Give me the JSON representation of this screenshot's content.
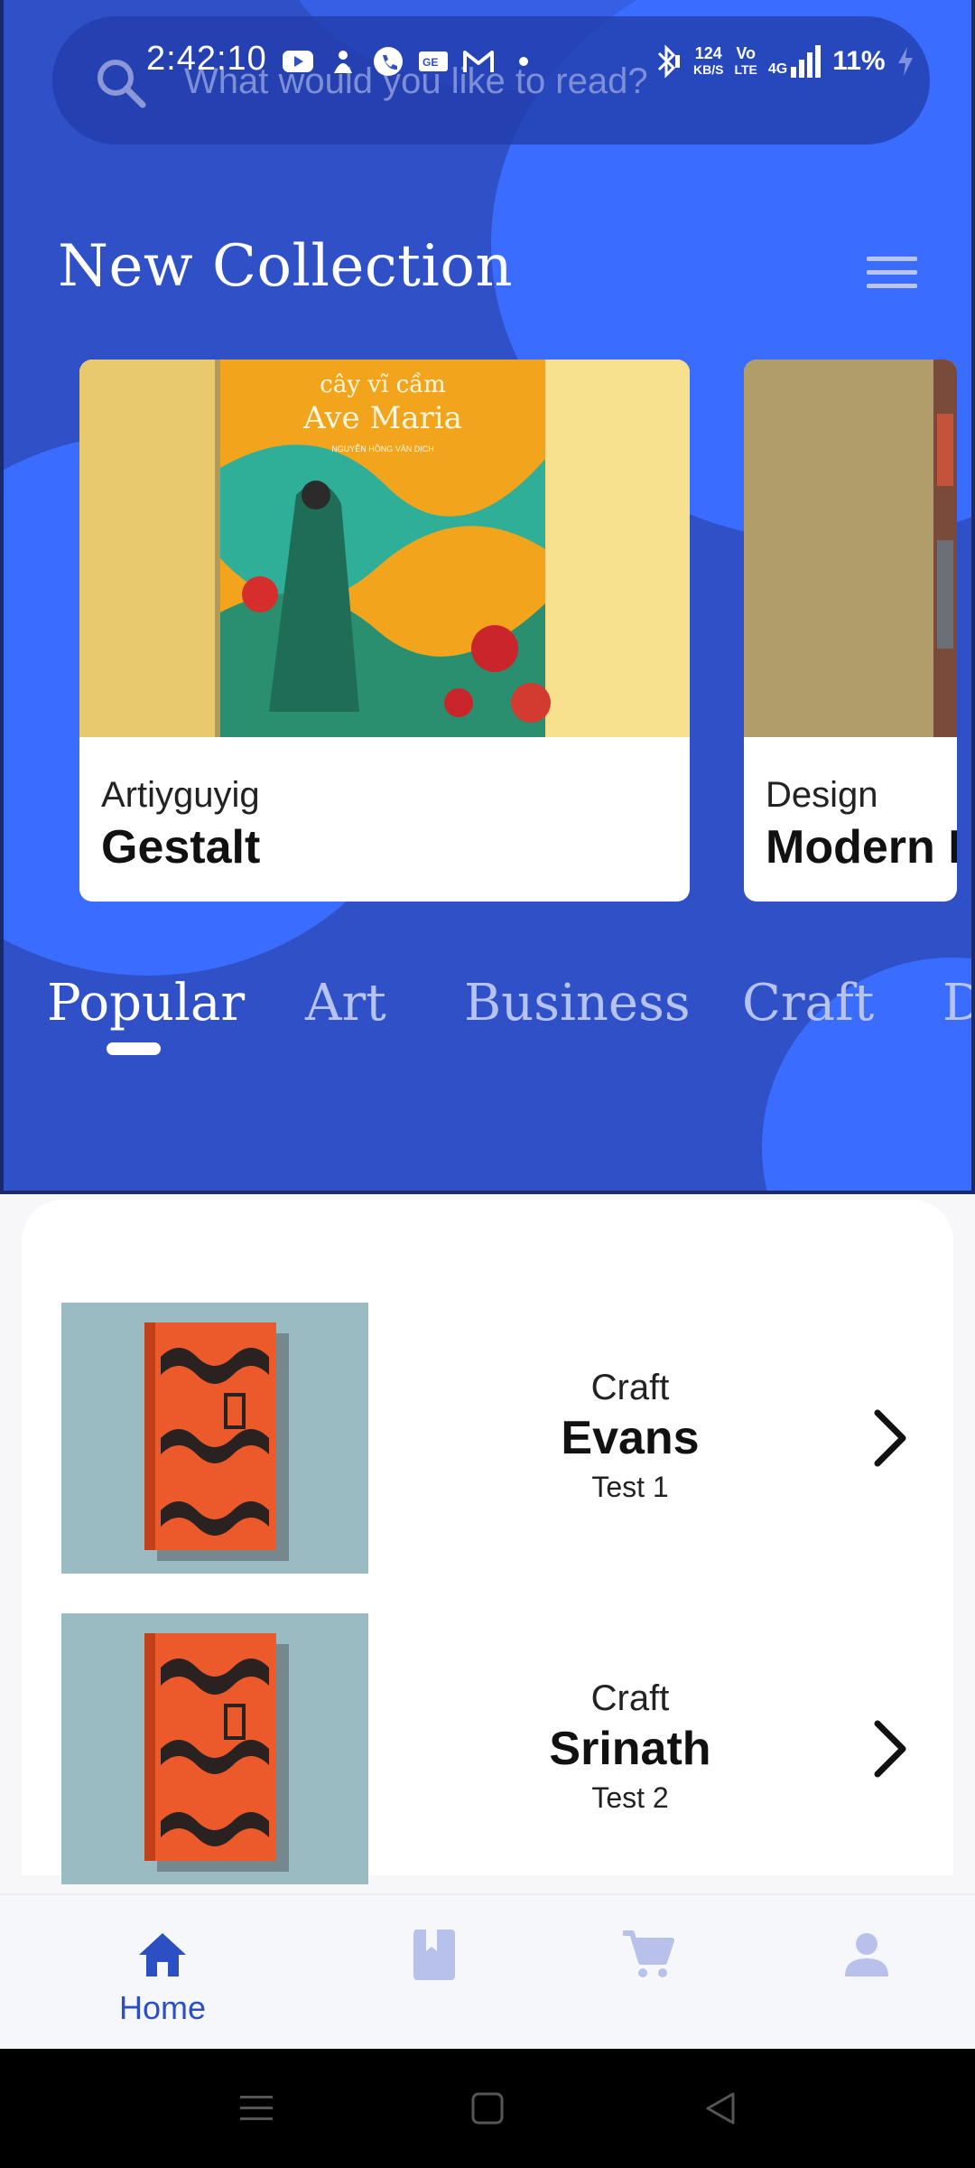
{
  "status_bar": {
    "time": "2:42:10",
    "net_speed_value": "124",
    "net_speed_unit": "KB/S",
    "volte_line1": "Vo",
    "volte_line2": "LTE",
    "network": "4G",
    "battery": "11%"
  },
  "search": {
    "placeholder": "What would you like to read?",
    "icon": "search-icon"
  },
  "header": {
    "title": "New Collection",
    "menu_icon": "menu-icon"
  },
  "collection": [
    {
      "category": "Artiyguyig",
      "title": "Gestalt",
      "cover_text_1": "cây vĩ cầm",
      "cover_text_2": "Ave Maria",
      "cover_text_3": "NGUYỄN HỒNG VÂN DỊCH"
    },
    {
      "category": "Design",
      "title": "Modern D"
    }
  ],
  "tabs": [
    {
      "label": "Popular",
      "active": true
    },
    {
      "label": "Art",
      "active": false
    },
    {
      "label": "Business",
      "active": false
    },
    {
      "label": "Craft",
      "active": false
    },
    {
      "label": "D",
      "active": false
    }
  ],
  "list": [
    {
      "category": "Craft",
      "title": "Evans",
      "subtitle": "Test 1"
    },
    {
      "category": "Craft",
      "title": "Srinath",
      "subtitle": "Test 2"
    }
  ],
  "bottom_nav": {
    "items": [
      {
        "label": "Home",
        "icon": "home-icon",
        "active": true
      },
      {
        "label": "",
        "icon": "book-icon",
        "active": false
      },
      {
        "label": "",
        "icon": "cart-icon",
        "active": false
      },
      {
        "label": "",
        "icon": "person-icon",
        "active": false
      }
    ]
  },
  "colors": {
    "hero_blue": "#2f50c7",
    "blob_blue": "#3a6cff",
    "accent": "#2d4fc4",
    "inactive_nav": "#b8c1ea"
  }
}
